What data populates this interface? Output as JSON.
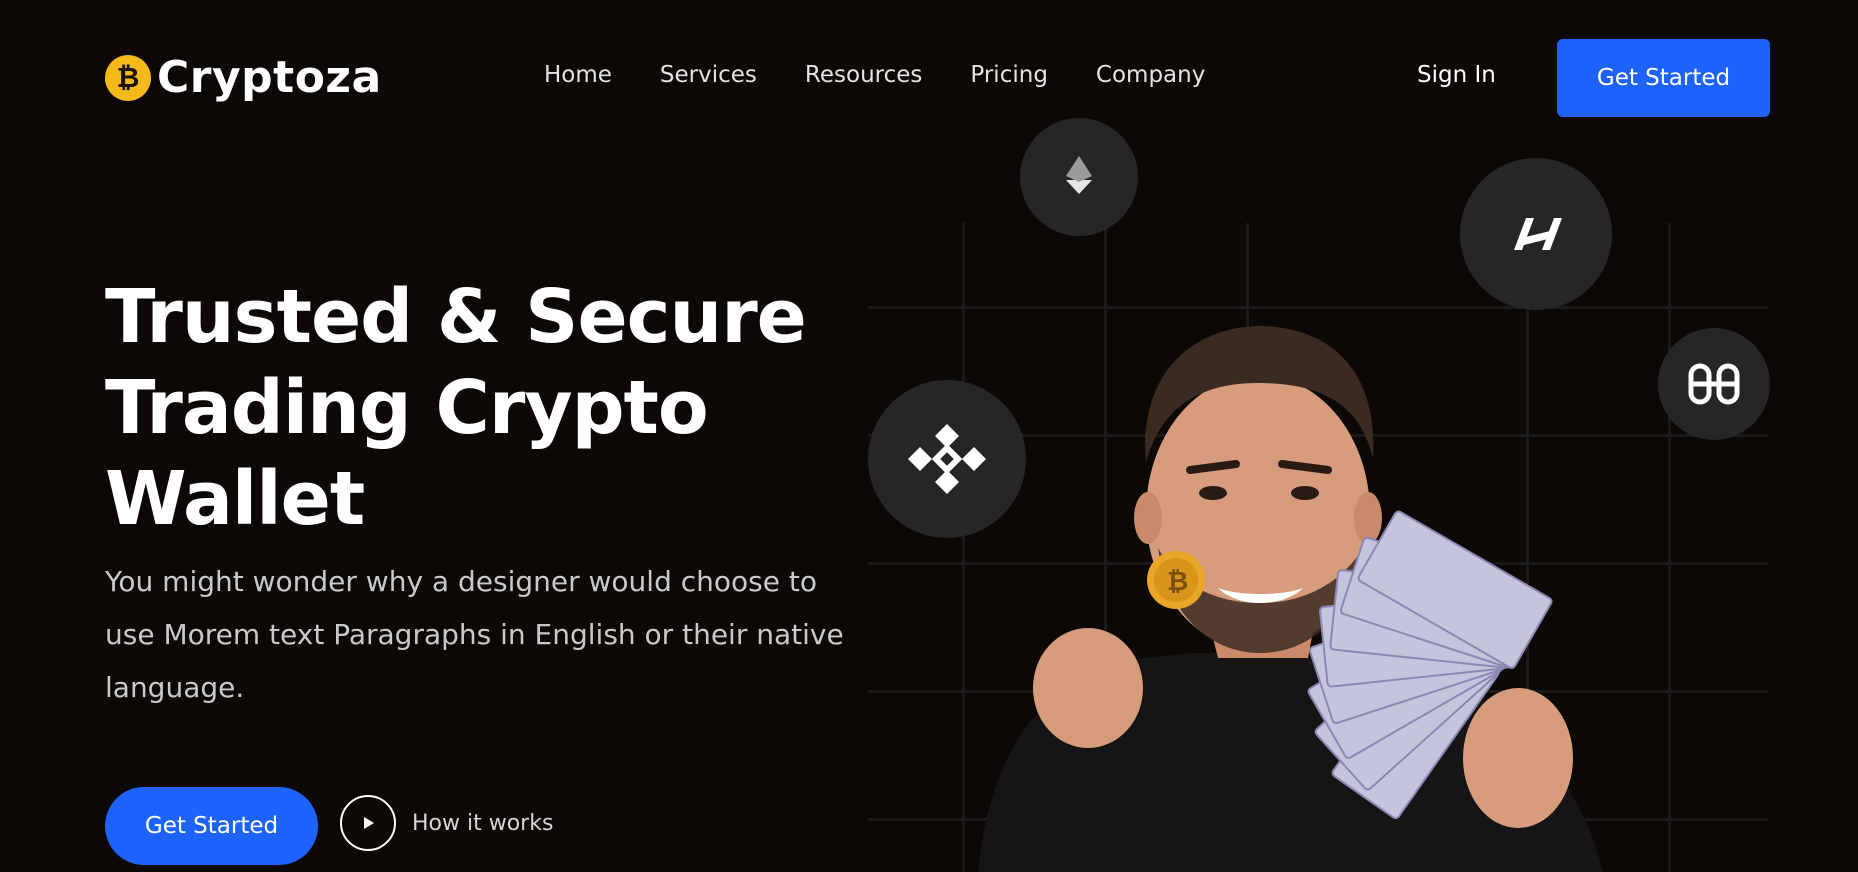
{
  "brand": {
    "name": "Cryptoza",
    "icon": "bitcoin-icon",
    "color": "#f6b91a"
  },
  "nav": {
    "items": [
      {
        "label": "Home"
      },
      {
        "label": "Services"
      },
      {
        "label": "Resources"
      },
      {
        "label": "Pricing"
      },
      {
        "label": "Company"
      }
    ],
    "signin_label": "Sign In",
    "get_started_label": "Get Started"
  },
  "hero": {
    "title": "Trusted & Secure Trading Crypto Wallet",
    "description": "You might wonder why a designer would choose to use Morem text Paragraphs in English or their native language.",
    "cta_label": "Get Started",
    "how_label": "How it works"
  },
  "art": {
    "badges": [
      {
        "name": "ethereum-icon"
      },
      {
        "name": "harmony-icon"
      },
      {
        "name": "binance-icon"
      },
      {
        "name": "wallet-logo-icon"
      }
    ]
  },
  "colors": {
    "background": "#0b0806",
    "accent": "#1e63ff",
    "badge": "#262626",
    "text_muted": "#c9c9c9"
  }
}
